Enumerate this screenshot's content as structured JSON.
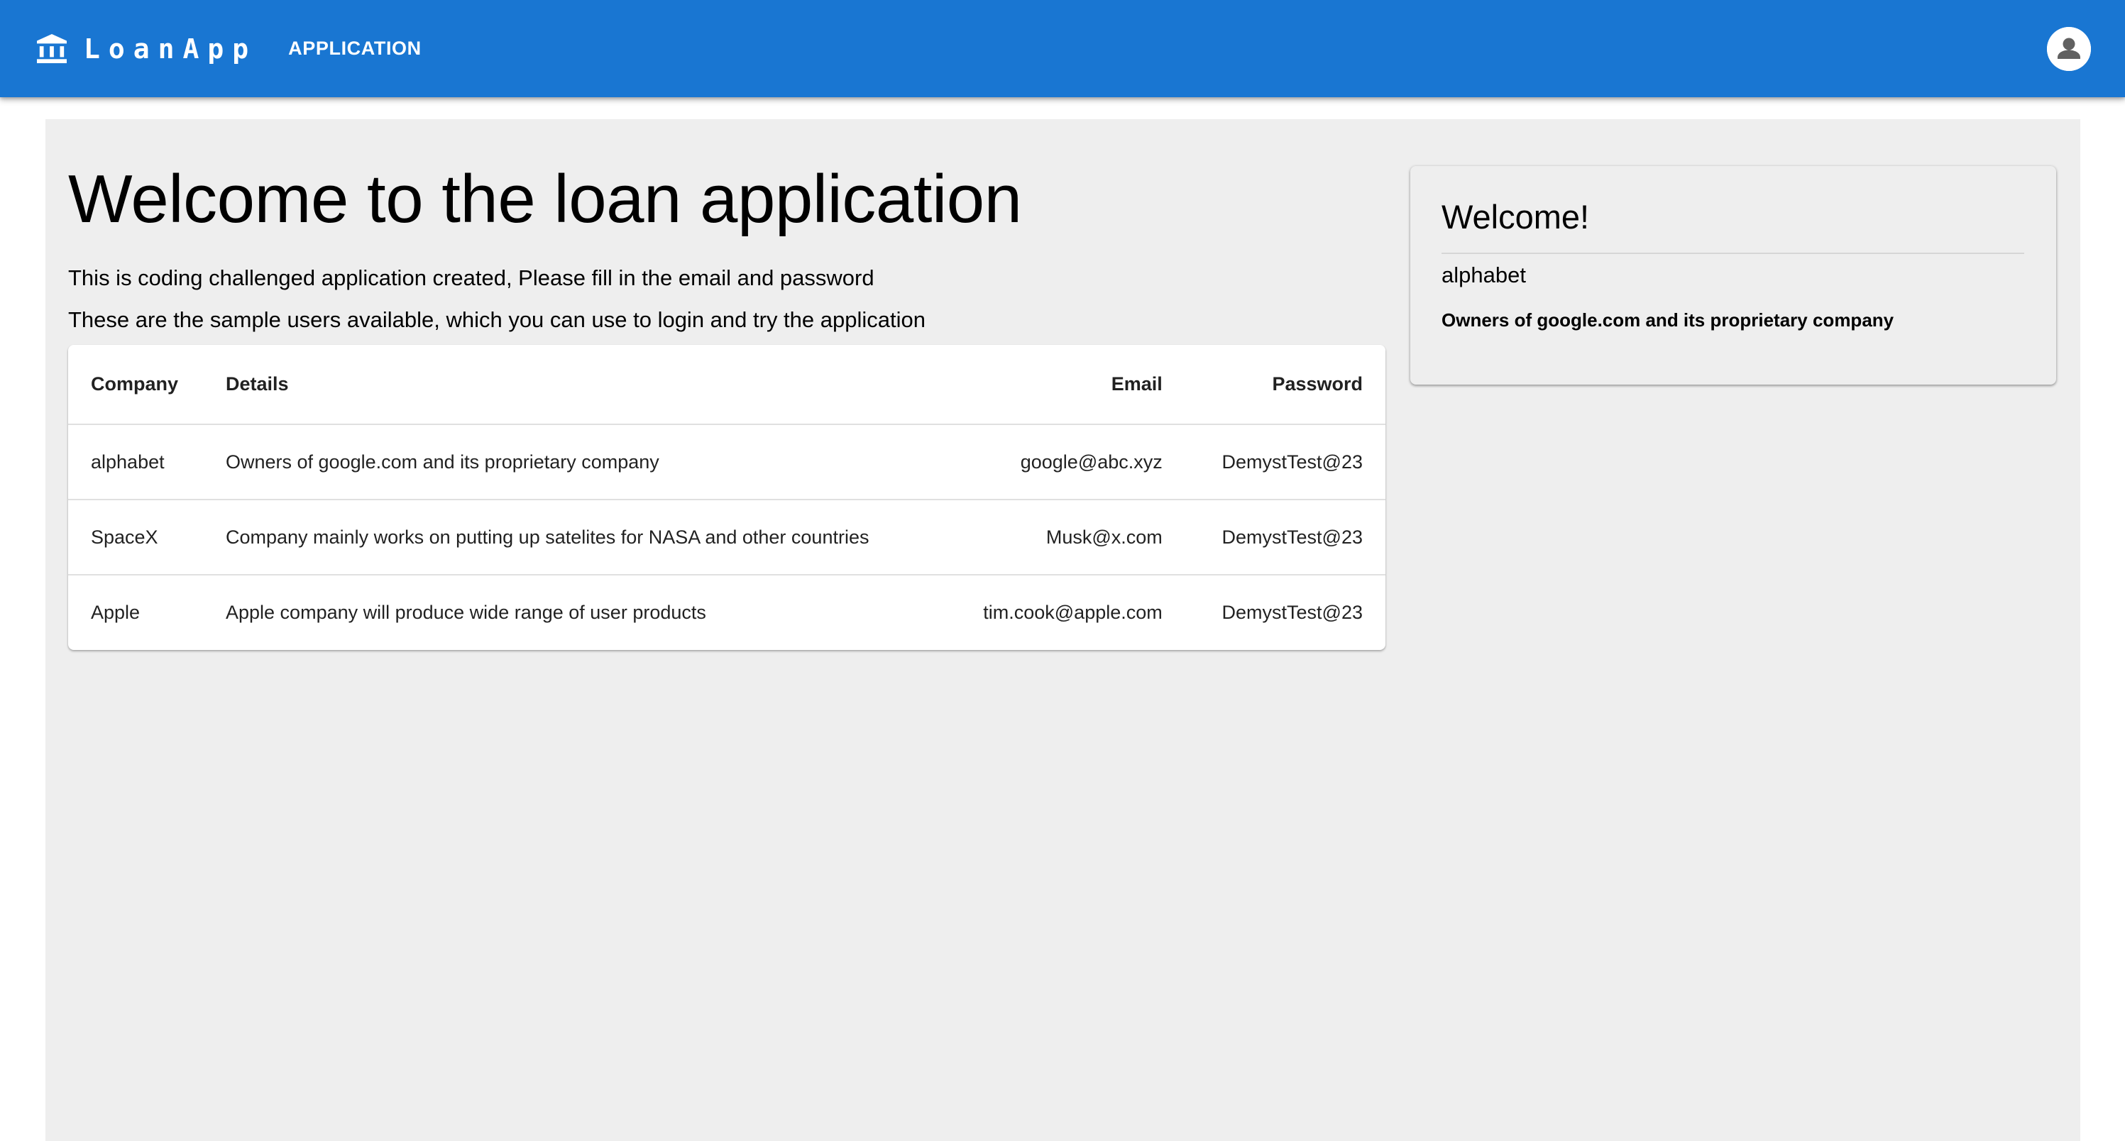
{
  "header": {
    "brand": "LoanApp",
    "brand_icon": "bank-icon",
    "nav": {
      "application_label": "APPLICATION"
    },
    "account_icon": "account-circle-icon",
    "bg_color": "#1976d2"
  },
  "main": {
    "title": "Welcome to the loan application",
    "intro_line1": "This is coding challenged application created, Please fill in the email and password",
    "intro_line2": "These are the sample users available, which you can use to login and try the application"
  },
  "table": {
    "columns": [
      "Company",
      "Details",
      "Email",
      "Password"
    ],
    "rows": [
      [
        "alphabet",
        "Owners of google.com and its proprietary company",
        "google@abc.xyz",
        "DemystTest@23"
      ],
      [
        "SpaceX",
        "Company mainly works on putting up satelites for NASA and other countries",
        "Musk@x.com",
        "DemystTest@23"
      ],
      [
        "Apple",
        "Apple company will produce wide range of user products",
        "tim.cook@apple.com",
        "DemystTest@23"
      ]
    ]
  },
  "welcome_card": {
    "title": "Welcome!",
    "company": "alphabet",
    "details": "Owners of google.com and its proprietary company"
  }
}
